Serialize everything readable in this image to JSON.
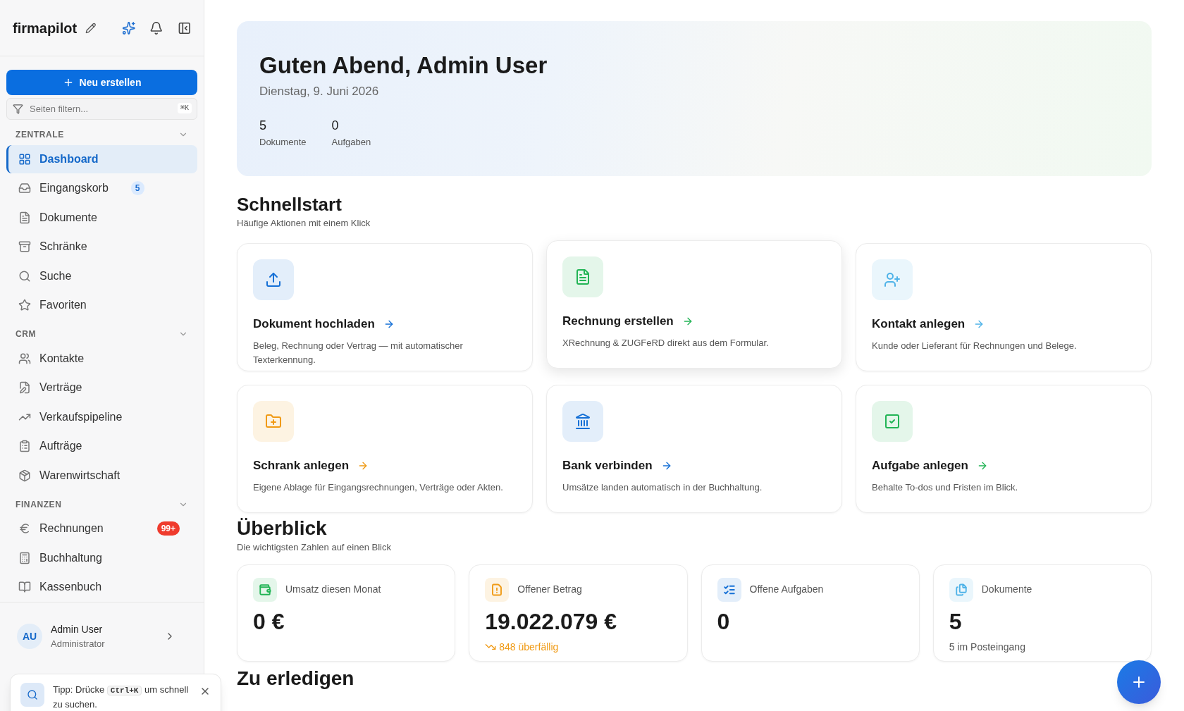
{
  "sidebar": {
    "brand": "firmapilot",
    "new_button": "Neu erstellen",
    "filter": {
      "placeholder": "Seiten filtern...",
      "shortcut": "⌘K"
    },
    "sections": [
      {
        "title": "ZENTRALE",
        "expanded": true,
        "items": [
          {
            "label": "Dashboard",
            "selected": true
          },
          {
            "label": "Eingangskorb",
            "selected": false,
            "badge": {
              "text": "5",
              "kind": "info"
            }
          },
          {
            "label": "Dokumente",
            "selected": false
          },
          {
            "label": "Schränke",
            "selected": false
          },
          {
            "label": "Suche",
            "selected": false
          },
          {
            "label": "Favoriten",
            "selected": false
          }
        ]
      },
      {
        "title": "CRM",
        "expanded": true,
        "items": [
          {
            "label": "Kontakte",
            "selected": false
          },
          {
            "label": "Verträge",
            "selected": false
          },
          {
            "label": "Verkaufspipeline",
            "selected": false
          },
          {
            "label": "Aufträge",
            "selected": false
          },
          {
            "label": "Warenwirtschaft",
            "selected": false
          }
        ]
      },
      {
        "title": "FINANZEN",
        "expanded": true,
        "items": [
          {
            "label": "Rechnungen",
            "selected": false,
            "badge": {
              "text": "99+",
              "kind": "alert"
            }
          },
          {
            "label": "Buchhaltung",
            "selected": false
          },
          {
            "label": "Kassenbuch",
            "selected": false
          }
        ]
      }
    ],
    "user": {
      "initials": "AU",
      "name": "Admin User",
      "role": "Administrator"
    }
  },
  "hero": {
    "greeting": "Guten Abend, Admin User",
    "date": "Dienstag, 9. Juni 2026",
    "stats": [
      {
        "value": "5",
        "label": "Dokumente"
      },
      {
        "value": "0",
        "label": "Aufgaben"
      }
    ]
  },
  "quickstart": {
    "title": "Schnellstart",
    "subtitle": "Häufige Aktionen mit einem Klick",
    "cards": [
      {
        "title": "Dokument hochladen",
        "text": "Beleg, Rechnung oder Vertrag — mit automatischer Texterkennung.",
        "color": "#1570d6",
        "hovered": false
      },
      {
        "title": "Rechnung erstellen",
        "text": "XRechnung & ZUGFeRD direkt aus dem Formular.",
        "color": "#22b455",
        "hovered": true
      },
      {
        "title": "Kontakt anlegen",
        "text": "Kunde oder Lieferant für Rechnungen und Belege.",
        "color": "#4fb3e8",
        "hovered": false
      },
      {
        "title": "Schrank anlegen",
        "text": "Eigene Ablage für Eingangsrechnungen, Verträge oder Akten.",
        "color": "#f09a14",
        "hovered": false
      },
      {
        "title": "Bank verbinden",
        "text": "Umsätze landen automatisch in der Buchhaltung.",
        "color": "#1570d6",
        "hovered": false
      },
      {
        "title": "Aufgabe anlegen",
        "text": "Behalte To-dos und Fristen im Blick.",
        "color": "#22b455",
        "hovered": false
      }
    ]
  },
  "overview": {
    "title": "Überblick",
    "subtitle": "Die wichtigsten Zahlen auf einen Blick",
    "cards": [
      {
        "label": "Umsatz diesen Monat",
        "value": "0 €",
        "color": "#22b455"
      },
      {
        "label": "Offener Betrag",
        "value": "19.022.079 €",
        "color": "#f09a14",
        "note": {
          "text": "848 überfällig",
          "kind": "warning"
        }
      },
      {
        "label": "Offene Aufgaben",
        "value": "0",
        "color": "#1570d6"
      },
      {
        "label": "Dokumente",
        "value": "5",
        "color": "#4fb3e8",
        "note": {
          "text": "5 im Posteingang",
          "kind": "neutral"
        }
      }
    ]
  },
  "next_section": {
    "title": "Zu erledigen"
  },
  "toast": {
    "before": "Tipp: Drücke",
    "key": "Ctrl+K",
    "after": "um schnell zu suchen."
  }
}
